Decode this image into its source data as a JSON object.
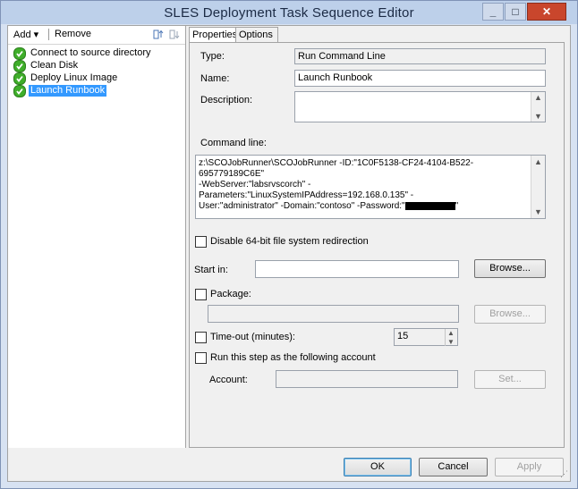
{
  "window": {
    "title": "SLES Deployment Task Sequence Editor"
  },
  "titlebar": {
    "minimize": "_",
    "maximize": "□",
    "close": "✕"
  },
  "toolbar": {
    "add": "Add ▾",
    "remove": "Remove",
    "icons": [
      "move-up-icon",
      "move-down-icon"
    ]
  },
  "tree": {
    "items": [
      {
        "label": "Connect to source directory",
        "status": "success"
      },
      {
        "label": "Clean Disk",
        "status": "success"
      },
      {
        "label": "Deploy Linux Image",
        "status": "success"
      },
      {
        "label": "Launch Runbook",
        "status": "success",
        "selected": true
      }
    ]
  },
  "tabs": [
    "Properties",
    "Options"
  ],
  "properties": {
    "type_label": "Type:",
    "type_value": "Run Command Line",
    "name_label": "Name:",
    "name_value": "Launch Runbook",
    "description_label": "Description:",
    "description_value": "",
    "cmdline_label": "Command line:",
    "cmdline_lines": [
      "z:\\SCOJobRunner\\SCOJobRunner -ID:\"1C0F5138-CF24-4104-B522-695779189C6E\"",
      "-WebServer:\"labsrvscorch\" -Parameters:\"LinuxSystemIPAddress=192.168.0.135\" -",
      "User:\"administrator\" -Domain:\"contoso\" -Password:\""
    ],
    "cmdline_tail": "\"",
    "disable_redirection_label": "Disable 64-bit file system redirection",
    "startin_label": "Start in:",
    "startin_value": "",
    "browse_label": "Browse...",
    "package_label": "Package:",
    "package_value": "",
    "package_browse_label": "Browse...",
    "timeout_label": "Time-out (minutes):",
    "timeout_value": "15",
    "runas_label": "Run this step as the following account",
    "account_label": "Account:",
    "account_value": "",
    "set_label": "Set..."
  },
  "dialog_buttons": {
    "ok": "OK",
    "cancel": "Cancel",
    "apply": "Apply"
  },
  "colors": {
    "selection": "#3399ff",
    "success": "#3fae2a",
    "close_button": "#c9462c"
  }
}
